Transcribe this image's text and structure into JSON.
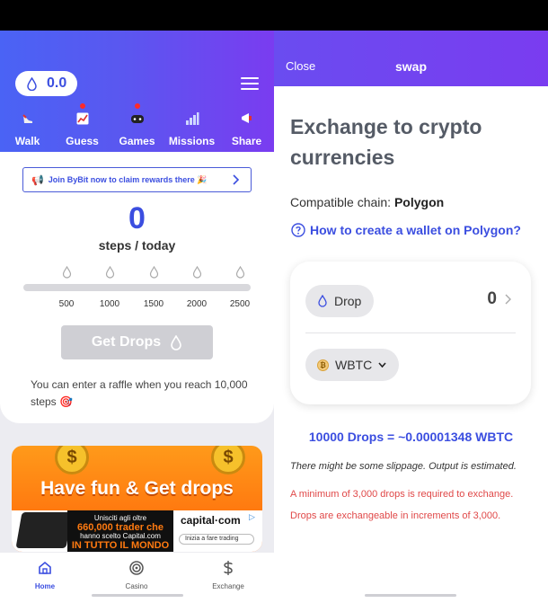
{
  "left": {
    "balance": "0.0",
    "tabs": [
      {
        "label": "Walk",
        "icon": "shoe-icon",
        "active": true,
        "dot": false
      },
      {
        "label": "Guess",
        "icon": "chart-icon",
        "active": false,
        "dot": true
      },
      {
        "label": "Games",
        "icon": "gamepad-icon",
        "active": false,
        "dot": true
      },
      {
        "label": "Missions",
        "icon": "bar-chart-icon",
        "active": false,
        "dot": false
      },
      {
        "label": "Share",
        "icon": "megaphone-icon",
        "active": false,
        "dot": false
      }
    ],
    "banner_text": "Join ByBit now to claim rewards there 🎉",
    "steps_count": "0",
    "steps_label": "steps / today",
    "progress": 0,
    "milestones": [
      "500",
      "1000",
      "1500",
      "2000",
      "2500"
    ],
    "get_drops_label": "Get Drops",
    "raffle_text": "You can enter a raffle when you reach 10,000 steps 🎯",
    "ad": {
      "title": "Have fun & Get drops",
      "dark_line1": "Unisciti agli oltre",
      "dark_line2": "660,000 trader che",
      "dark_line3": "hanno scelto Capital.com",
      "dark_line4": "IN TUTTO IL MONDO",
      "brand": "capital·com",
      "cta": "Inizia a fare trading"
    },
    "bottom_nav": [
      {
        "label": "Home",
        "icon": "home-icon",
        "active": true
      },
      {
        "label": "Casino",
        "icon": "target-icon",
        "active": false
      },
      {
        "label": "Exchange",
        "icon": "dollar-icon",
        "active": false
      }
    ]
  },
  "right": {
    "close_label": "Close",
    "header_title": "swap",
    "exchange_title": "Exchange to crypto currencies",
    "chain_label": "Compatible chain:",
    "chain_value": "Polygon",
    "howto_label": "How to create a wallet on Polygon?",
    "from_token": "Drop",
    "from_amount": "0",
    "to_token": "WBTC",
    "rate_text": "10000 Drops = ~0.00001348 WBTC",
    "slippage_text": "There might be some slippage. Output is estimated.",
    "min_note": "A minimum of 3,000 drops is required to exchange.",
    "increment_note": "Drops are exchangeable in increments of 3,000."
  },
  "colors": {
    "accent_blue": "#3b4ee0",
    "header_gradient_start": "#4a63f5",
    "header_gradient_end": "#7a3cf0",
    "warning_red": "#e04848",
    "ad_orange": "#ff8a1a"
  }
}
